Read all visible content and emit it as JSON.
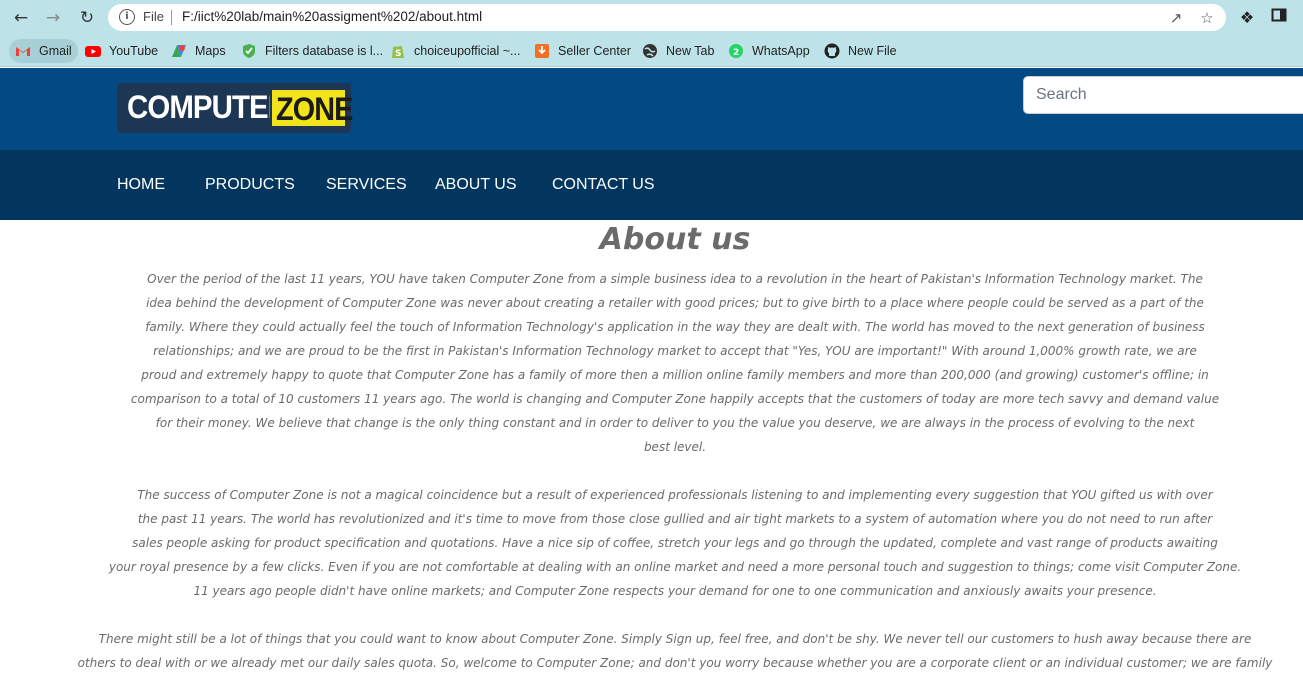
{
  "browser": {
    "file_label": "File",
    "url": "F:/iict%20lab/main%20assigment%202/about.html",
    "bookmarks": [
      {
        "label": "Gmail",
        "icon": "gmail-icon"
      },
      {
        "label": "YouTube",
        "icon": "youtube-icon"
      },
      {
        "label": "Maps",
        "icon": "maps-icon"
      },
      {
        "label": "Filters database is l...",
        "icon": "shield-icon"
      },
      {
        "label": "choiceupofficial ~...",
        "icon": "shopify-icon"
      },
      {
        "label": "Seller Center",
        "icon": "seller-center-icon"
      },
      {
        "label": "New Tab",
        "icon": "globe-icon"
      },
      {
        "label": "WhatsApp",
        "icon": "whatsapp-icon"
      },
      {
        "label": "New File",
        "icon": "github-icon"
      }
    ]
  },
  "header": {
    "logo_part1": "COMPUTER",
    "logo_part2": "ZONE",
    "search_placeholder": "Search"
  },
  "nav": {
    "items": [
      "HOME",
      "PRODUCTS",
      "SERVICES",
      "ABOUT US",
      "CONTACT US"
    ]
  },
  "content": {
    "title": "About us",
    "paragraph1": [
      "Over the period of the last 11 years, YOU have taken Computer Zone from a simple business idea to a revolution in the heart of Pakistan's Information Technology market. The",
      "idea behind the development of Computer Zone was never about creating a retailer with good prices; but to give birth to a place where people could be served as a part of the",
      "family. Where they could actually feel the touch of Information Technology's application in the way they are dealt with. The world has moved to the next generation of business",
      "relationships; and we are proud to be the first in Pakistan's Information Technology market to accept that \"Yes, YOU are important!\" With around 1,000% growth rate, we are",
      "proud and extremely happy to quote that Computer Zone has a family of more then a million online family members and more than 200,000 (and growing) customer's offline; in",
      "comparison to a total of 10 customers 11 years ago. The world is changing and Computer Zone happily accepts that the customers of today are more tech savvy and demand value",
      "for their money. We believe that change is the only thing constant and in order to deliver to you the value you deserve, we are always in the process of evolving to the next",
      "best level."
    ],
    "paragraph2": [
      "The success of Computer Zone is not a magical coincidence but a result of experienced professionals listening to and implementing every suggestion that YOU gifted us with over",
      "the past 11 years. The world has revolutionized and it's time to move from those close gullied and air tight markets to a system of automation where you do not need to run after",
      "sales people asking for product specification and quotations. Have a nice sip of coffee, stretch your legs and go through the updated, complete and vast range of products awaiting",
      "your royal presence by a few clicks. Even if you are not comfortable at dealing with an online market and need a more personal touch and suggestion to things; come visit Computer Zone.",
      "11 years ago people didn't have online markets; and Computer Zone respects your demand for one to one communication and anxiously awaits your presence."
    ],
    "paragraph3": [
      "There might still be a lot of things that you could want to know about Computer Zone. Simply Sign up, feel free, and don't be shy. We never tell our customers to hush away because there are",
      "others to deal with or we already met our daily sales quota. So, welcome to Computer Zone; and don't you worry because whether you are a corporate client or an individual customer; we are family"
    ]
  },
  "colors": {
    "header_bg": "#034a85",
    "nav_bg": "#02365f",
    "chrome_bg": "#bde3e8",
    "logo_yellow": "#f3e31c",
    "text_gray": "#6b6b6b"
  }
}
